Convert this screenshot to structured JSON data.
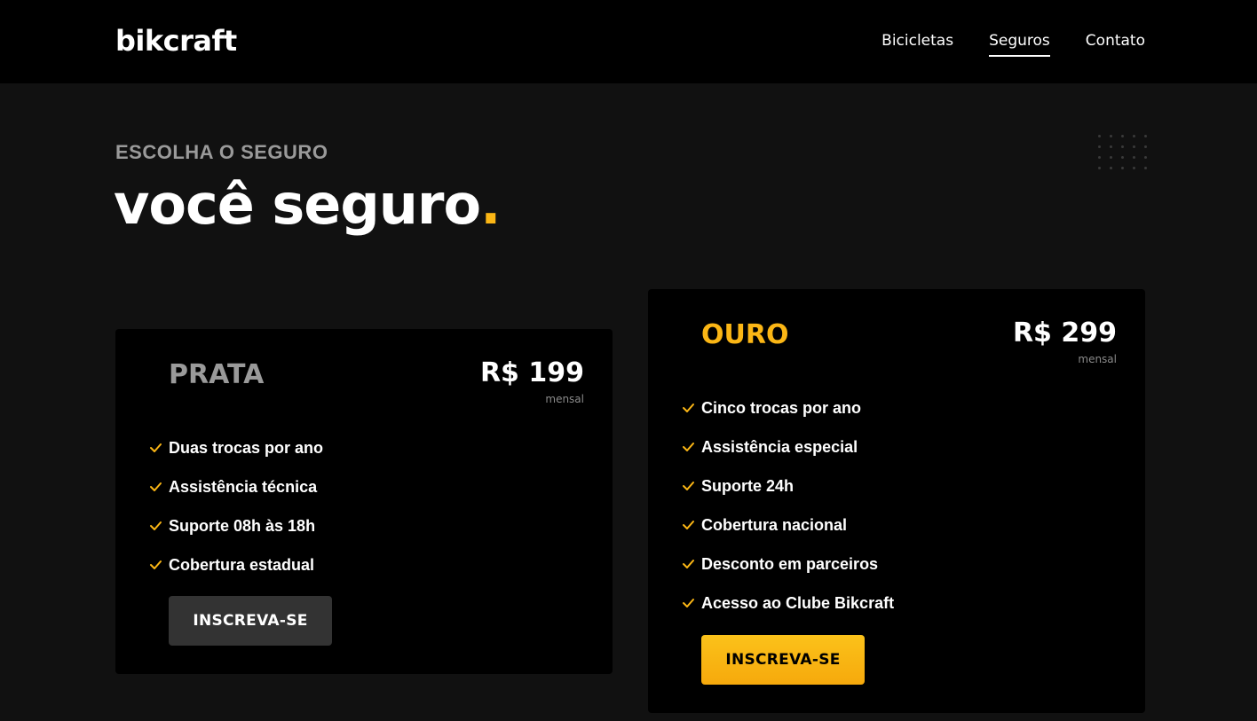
{
  "header": {
    "logo": "bikcraft",
    "nav": [
      {
        "label": "Bicicletas",
        "active": false
      },
      {
        "label": "Seguros",
        "active": true
      },
      {
        "label": "Contato",
        "active": false
      }
    ]
  },
  "hero": {
    "eyebrow": "ESCOLHA O SEGURO",
    "title": "você seguro",
    "title_dot": "."
  },
  "colors": {
    "accent": "#fbb615",
    "background": "#111111",
    "card": "#000000",
    "muted": "#9a9a9a"
  },
  "plans": [
    {
      "name": "PRATA",
      "price": "R$ 199",
      "period": "mensal",
      "features": [
        "Duas trocas por ano",
        "Assistência técnica",
        "Suporte 08h às 18h",
        "Cobertura estadual"
      ],
      "button": "INSCREVA-SE",
      "check_icon": "check-icon"
    },
    {
      "name": "OURO",
      "price": "R$ 299",
      "period": "mensal",
      "features": [
        "Cinco trocas por ano",
        "Assistência especial",
        "Suporte 24h",
        "Cobertura nacional",
        "Desconto em parceiros",
        "Acesso ao Clube Bikcraft"
      ],
      "button": "INSCREVA-SE",
      "check_icon": "check-icon"
    }
  ]
}
